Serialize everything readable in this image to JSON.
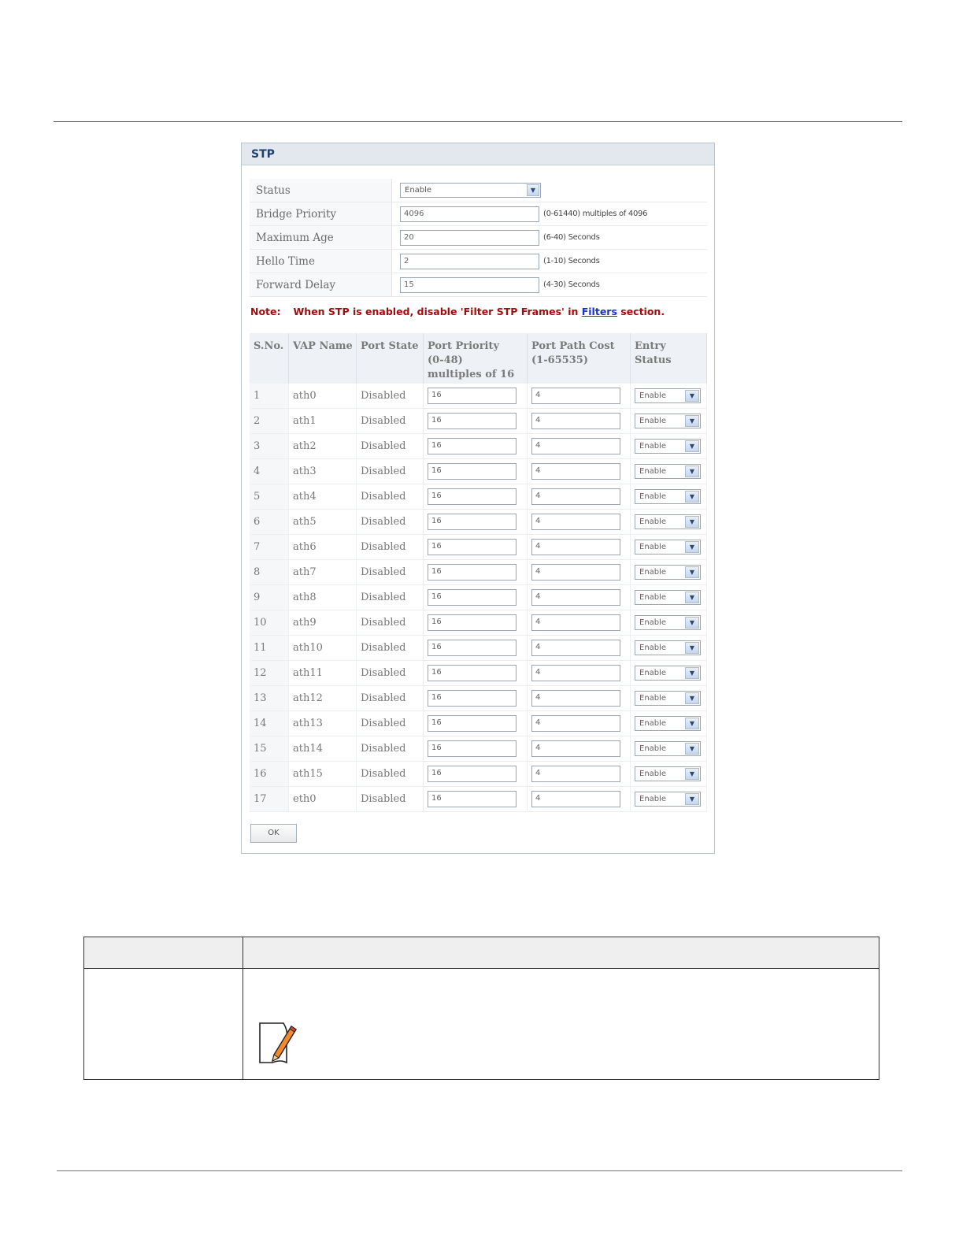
{
  "panel": {
    "title": "STP"
  },
  "settings": {
    "status": {
      "label": "Status",
      "value": "Enable"
    },
    "bridge_priority": {
      "label": "Bridge Priority",
      "value": "4096",
      "hint": "(0-61440) multiples of 4096"
    },
    "max_age": {
      "label": "Maximum Age",
      "value": "20",
      "hint": "(6-40) Seconds"
    },
    "hello_time": {
      "label": "Hello Time",
      "value": "2",
      "hint": "(1-10) Seconds"
    },
    "forward_delay": {
      "label": "Forward Delay",
      "value": "15",
      "hint": "(4-30) Seconds"
    }
  },
  "note": {
    "label": "Note:",
    "text_before": "When STP is enabled, disable 'Filter STP Frames' in ",
    "link": "Filters",
    "text_after": " section."
  },
  "ports": {
    "headers": {
      "sno": "S.No.",
      "vap": "VAP Name",
      "state": "Port State",
      "priority_1": "Port Priority",
      "priority_2": "(0-48)",
      "priority_3": "multiples of 16",
      "cost_1": "Port Path Cost",
      "cost_2": "(1-65535)",
      "entry": "Entry Status"
    },
    "rows": [
      {
        "sno": "1",
        "vap": "ath0",
        "state": "Disabled",
        "priority": "16",
        "cost": "4",
        "entry": "Enable"
      },
      {
        "sno": "2",
        "vap": "ath1",
        "state": "Disabled",
        "priority": "16",
        "cost": "4",
        "entry": "Enable"
      },
      {
        "sno": "3",
        "vap": "ath2",
        "state": "Disabled",
        "priority": "16",
        "cost": "4",
        "entry": "Enable"
      },
      {
        "sno": "4",
        "vap": "ath3",
        "state": "Disabled",
        "priority": "16",
        "cost": "4",
        "entry": "Enable"
      },
      {
        "sno": "5",
        "vap": "ath4",
        "state": "Disabled",
        "priority": "16",
        "cost": "4",
        "entry": "Enable"
      },
      {
        "sno": "6",
        "vap": "ath5",
        "state": "Disabled",
        "priority": "16",
        "cost": "4",
        "entry": "Enable"
      },
      {
        "sno": "7",
        "vap": "ath6",
        "state": "Disabled",
        "priority": "16",
        "cost": "4",
        "entry": "Enable"
      },
      {
        "sno": "8",
        "vap": "ath7",
        "state": "Disabled",
        "priority": "16",
        "cost": "4",
        "entry": "Enable"
      },
      {
        "sno": "9",
        "vap": "ath8",
        "state": "Disabled",
        "priority": "16",
        "cost": "4",
        "entry": "Enable"
      },
      {
        "sno": "10",
        "vap": "ath9",
        "state": "Disabled",
        "priority": "16",
        "cost": "4",
        "entry": "Enable"
      },
      {
        "sno": "11",
        "vap": "ath10",
        "state": "Disabled",
        "priority": "16",
        "cost": "4",
        "entry": "Enable"
      },
      {
        "sno": "12",
        "vap": "ath11",
        "state": "Disabled",
        "priority": "16",
        "cost": "4",
        "entry": "Enable"
      },
      {
        "sno": "13",
        "vap": "ath12",
        "state": "Disabled",
        "priority": "16",
        "cost": "4",
        "entry": "Enable"
      },
      {
        "sno": "14",
        "vap": "ath13",
        "state": "Disabled",
        "priority": "16",
        "cost": "4",
        "entry": "Enable"
      },
      {
        "sno": "15",
        "vap": "ath14",
        "state": "Disabled",
        "priority": "16",
        "cost": "4",
        "entry": "Enable"
      },
      {
        "sno": "16",
        "vap": "ath15",
        "state": "Disabled",
        "priority": "16",
        "cost": "4",
        "entry": "Enable"
      },
      {
        "sno": "17",
        "vap": "eth0",
        "state": "Disabled",
        "priority": "16",
        "cost": "4",
        "entry": "Enable"
      }
    ]
  },
  "ok_button": "OK",
  "icons": {
    "dropdown": "chevron-down-icon",
    "note": "note-pencil-icon"
  }
}
